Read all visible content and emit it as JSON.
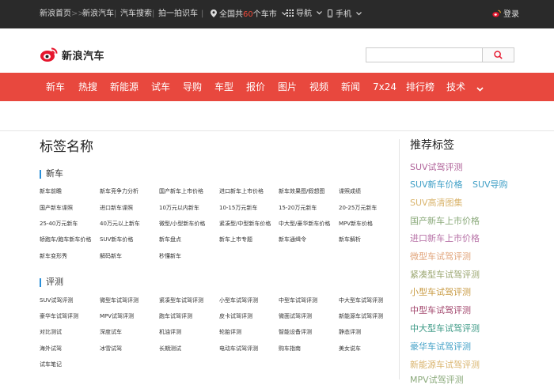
{
  "topbar": {
    "home": "新浪首页",
    "home_arrow": ">>",
    "auto": "新浪汽车",
    "sep": "|",
    "car_search": "汽车搜索",
    "photo_car": "拍一拍识车",
    "city_prefix": "全国共",
    "city_count": "60",
    "city_suffix": "个车市",
    "nav_label": "导航",
    "mobile_label": "手机",
    "login": "登录"
  },
  "header": {
    "logo_text": "新浪汽车",
    "search_placeholder": ""
  },
  "nav": {
    "items": [
      "新车",
      "热搜",
      "新能源",
      "试车",
      "导购",
      "车型",
      "报价",
      "图片",
      "视频",
      "新闻",
      "7x24",
      "排行榜",
      "技术"
    ]
  },
  "main": {
    "title": "标签名称",
    "sections": [
      {
        "label": "新车",
        "tags": [
          "新车前瞻",
          "新车竞争力分析",
          "国产新车上市价格",
          "进口新车上市价格",
          "新车效果图/假想图",
          "谍照成绩",
          "国产新车谍照",
          "进口新车谍照",
          "10万元以内新车",
          "10-15万元新车",
          "15-20万元新车",
          "20-25万元新车",
          "25-40万元新车",
          "40万元以上新车",
          "微型/小型新车价格",
          "紧凑型/中型新车价格",
          "中大型/豪华新车价格",
          "MPV新车价格",
          "轿跑车/跑车新车价格",
          "SUV新车价格",
          "新车盘点",
          "新车上市专题",
          "新车通缉令",
          "新车解析",
          "新车变形秀",
          "解码新车",
          "秒懂新车"
        ]
      },
      {
        "label": "评测",
        "tags": [
          "SUV试驾评测",
          "微型车试驾评测",
          "紧凑型车试驾评测",
          "小型车试驾评测",
          "中型车试驾评测",
          "中大型车试驾评测",
          "豪华车试驾评测",
          "MPV试驾评测",
          "跑车试驾评测",
          "皮卡试驾评测",
          "微面试驾评测",
          "新能源车试驾评测",
          "对比测试",
          "深度试车",
          "机油评测",
          "轮胎评测",
          "智能设备评测",
          "静态评测",
          "海外试驾",
          "冰雪试驾",
          "长期测试",
          "电动车试驾评测",
          "购车指南",
          "美女说车",
          "试车笔记"
        ]
      }
    ]
  },
  "sidebar": {
    "title": "推荐标签",
    "tags": [
      {
        "text": "SUV试驾评测",
        "color": "#b0649a"
      },
      {
        "text": "SUV新车价格",
        "color": "#3f9fc6"
      },
      {
        "text": "SUV导购",
        "color": "#3f9fc6"
      },
      {
        "text": "SUV高清图集",
        "color": "#d9b46d"
      },
      {
        "text": "国产新车上市价格",
        "color": "#8aa97a"
      },
      {
        "text": "进口新车上市价格",
        "color": "#b874a8"
      },
      {
        "text": "微型车试驾评测",
        "color": "#e1a47a"
      },
      {
        "text": "紧凑型车试驾评测",
        "color": "#9aa66f"
      },
      {
        "text": "小型车试驾评测",
        "color": "#c89a42"
      },
      {
        "text": "中型车试驾评测",
        "color": "#a2466c"
      },
      {
        "text": "中大型车试驾评测",
        "color": "#3d9a86"
      },
      {
        "text": "豪华车试驾评测",
        "color": "#3f9fc6"
      },
      {
        "text": "新能源车试驾评测",
        "color": "#d9b46d"
      },
      {
        "text": "MPV试驾评测",
        "color": "#8aa97a"
      }
    ]
  },
  "colors": {
    "nav_red": "#e8483e",
    "topbar": "#2a2a2a",
    "accent_bar": "#2a8fd8"
  }
}
